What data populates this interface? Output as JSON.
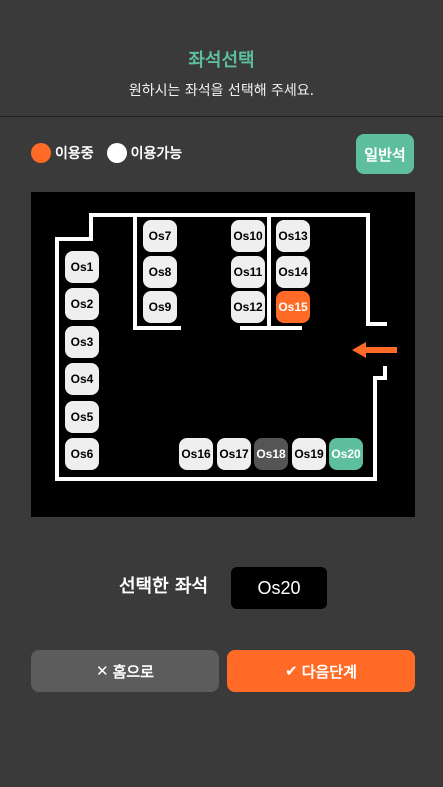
{
  "header": {
    "title": "좌석선택",
    "subtitle": "원하시는 좌석을 선택해 주세요."
  },
  "legend": {
    "busy_label": "이용중",
    "free_label": "이용가능"
  },
  "type_button": "일반석",
  "seats": {
    "os1": "Os1",
    "os2": "Os2",
    "os3": "Os3",
    "os4": "Os4",
    "os5": "Os5",
    "os6": "Os6",
    "os7": "Os7",
    "os8": "Os8",
    "os9": "Os9",
    "os10": "Os10",
    "os11": "Os11",
    "os12": "Os12",
    "os13": "Os13",
    "os14": "Os14",
    "os15": "Os15",
    "os16": "Os16",
    "os17": "Os17",
    "os18": "Os18",
    "os19": "Os19",
    "os20": "Os20"
  },
  "seat_status": {
    "in_use": [
      "Os15"
    ],
    "unavailable": [
      "Os18"
    ],
    "selected": "Os20"
  },
  "colors": {
    "accent_green": "#5dbf9e",
    "in_use_orange": "#ff6b26",
    "background": "#3a3a3a"
  },
  "selection": {
    "label": "선택한 좌석",
    "value": "Os20"
  },
  "actions": {
    "home": "홈으로",
    "next": "다음단계"
  },
  "icons": {
    "entrance": "entrance-arrow-icon",
    "home": "close-icon",
    "next": "check-icon"
  }
}
